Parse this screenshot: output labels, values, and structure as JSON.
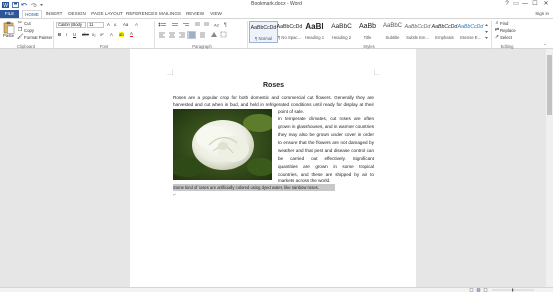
{
  "window": {
    "title": "Bookmark.docx - Word",
    "controls": {
      "help": "?",
      "restore_ribbon": "▭",
      "minimize": "—",
      "maximize": "☐",
      "close": "✕"
    }
  },
  "quick_access": {
    "icons": [
      "word-logo-icon",
      "save-icon",
      "undo-icon",
      "redo-icon",
      "customize-icon"
    ]
  },
  "tabs": {
    "file": "FILE",
    "items": [
      "HOME",
      "INSERT",
      "DESIGN",
      "PAGE LAYOUT",
      "REFERENCES",
      "MAILINGS",
      "REVIEW",
      "VIEW"
    ],
    "active": "HOME",
    "sign_in": "Sign in"
  },
  "ribbon": {
    "clipboard": {
      "paste": "Paste",
      "cut": "Cut",
      "copy": "Copy",
      "format_painter": "Format Painter",
      "label": "Clipboard"
    },
    "font": {
      "font_name": "Calibri (Body",
      "font_size": "11",
      "bold": "B",
      "italic": "I",
      "underline": "U",
      "strikethrough": "abc",
      "subscript": "x₂",
      "superscript": "x²",
      "grow": "A",
      "shrink": "A",
      "change_case": "Aa",
      "clear": "A",
      "text_effects": "A",
      "highlight": "ab",
      "font_color": "A",
      "label": "Font"
    },
    "paragraph": {
      "label": "Paragraph",
      "pilcrow": "¶"
    },
    "styles": {
      "label": "Styles",
      "items": [
        {
          "preview": "AaBbCcDd",
          "name": "¶ Normal"
        },
        {
          "preview": "AaBbCcDd",
          "name": "¶ No Spac..."
        },
        {
          "preview": "AaBl",
          "name": "Heading 1"
        },
        {
          "preview": "AaBbC",
          "name": "Heading 2"
        },
        {
          "preview": "AaBb",
          "name": "Title"
        },
        {
          "preview": "AaBbC",
          "name": "Subtitle"
        },
        {
          "preview": "AaBbCcDd",
          "name": "Subtle Em..."
        },
        {
          "preview": "AaBbCcDd",
          "name": "Emphasis"
        },
        {
          "preview": "AaBbCcDd",
          "name": "Intense E..."
        }
      ]
    },
    "editing": {
      "label": "Editing",
      "find": "Find",
      "replace": "Replace",
      "select": "Select"
    }
  },
  "document": {
    "title": "Roses",
    "para1": [
      "Roses are a popular crop for both domestic and commercial cut flowers. Generally they are",
      "harvested and cut when in bud, and held in refrigerated conditions until ready for display at their",
      "point of sale."
    ],
    "para2": [
      "In temperate climates, cut roses are often",
      "grown in glasshouses, and in warmer countries",
      "they may also be grown under cover in order",
      "to ensure that the flowers are not damaged by",
      "weather and that pest and disease control can",
      "be carried out effectively. Significant",
      "quantities are grown in some tropical",
      "countries, and these are shipped by air to",
      "markets across the world."
    ],
    "selected_text": "Some kind of roses are artificially colored using dyed water, like rainbow roses.",
    "image": "white-rose-photo"
  },
  "colors": {
    "accent": "#2b579a",
    "selection": "#c8c8c8",
    "ribbon_bg": "#ffffff",
    "canvas": "#e6e6e6"
  }
}
